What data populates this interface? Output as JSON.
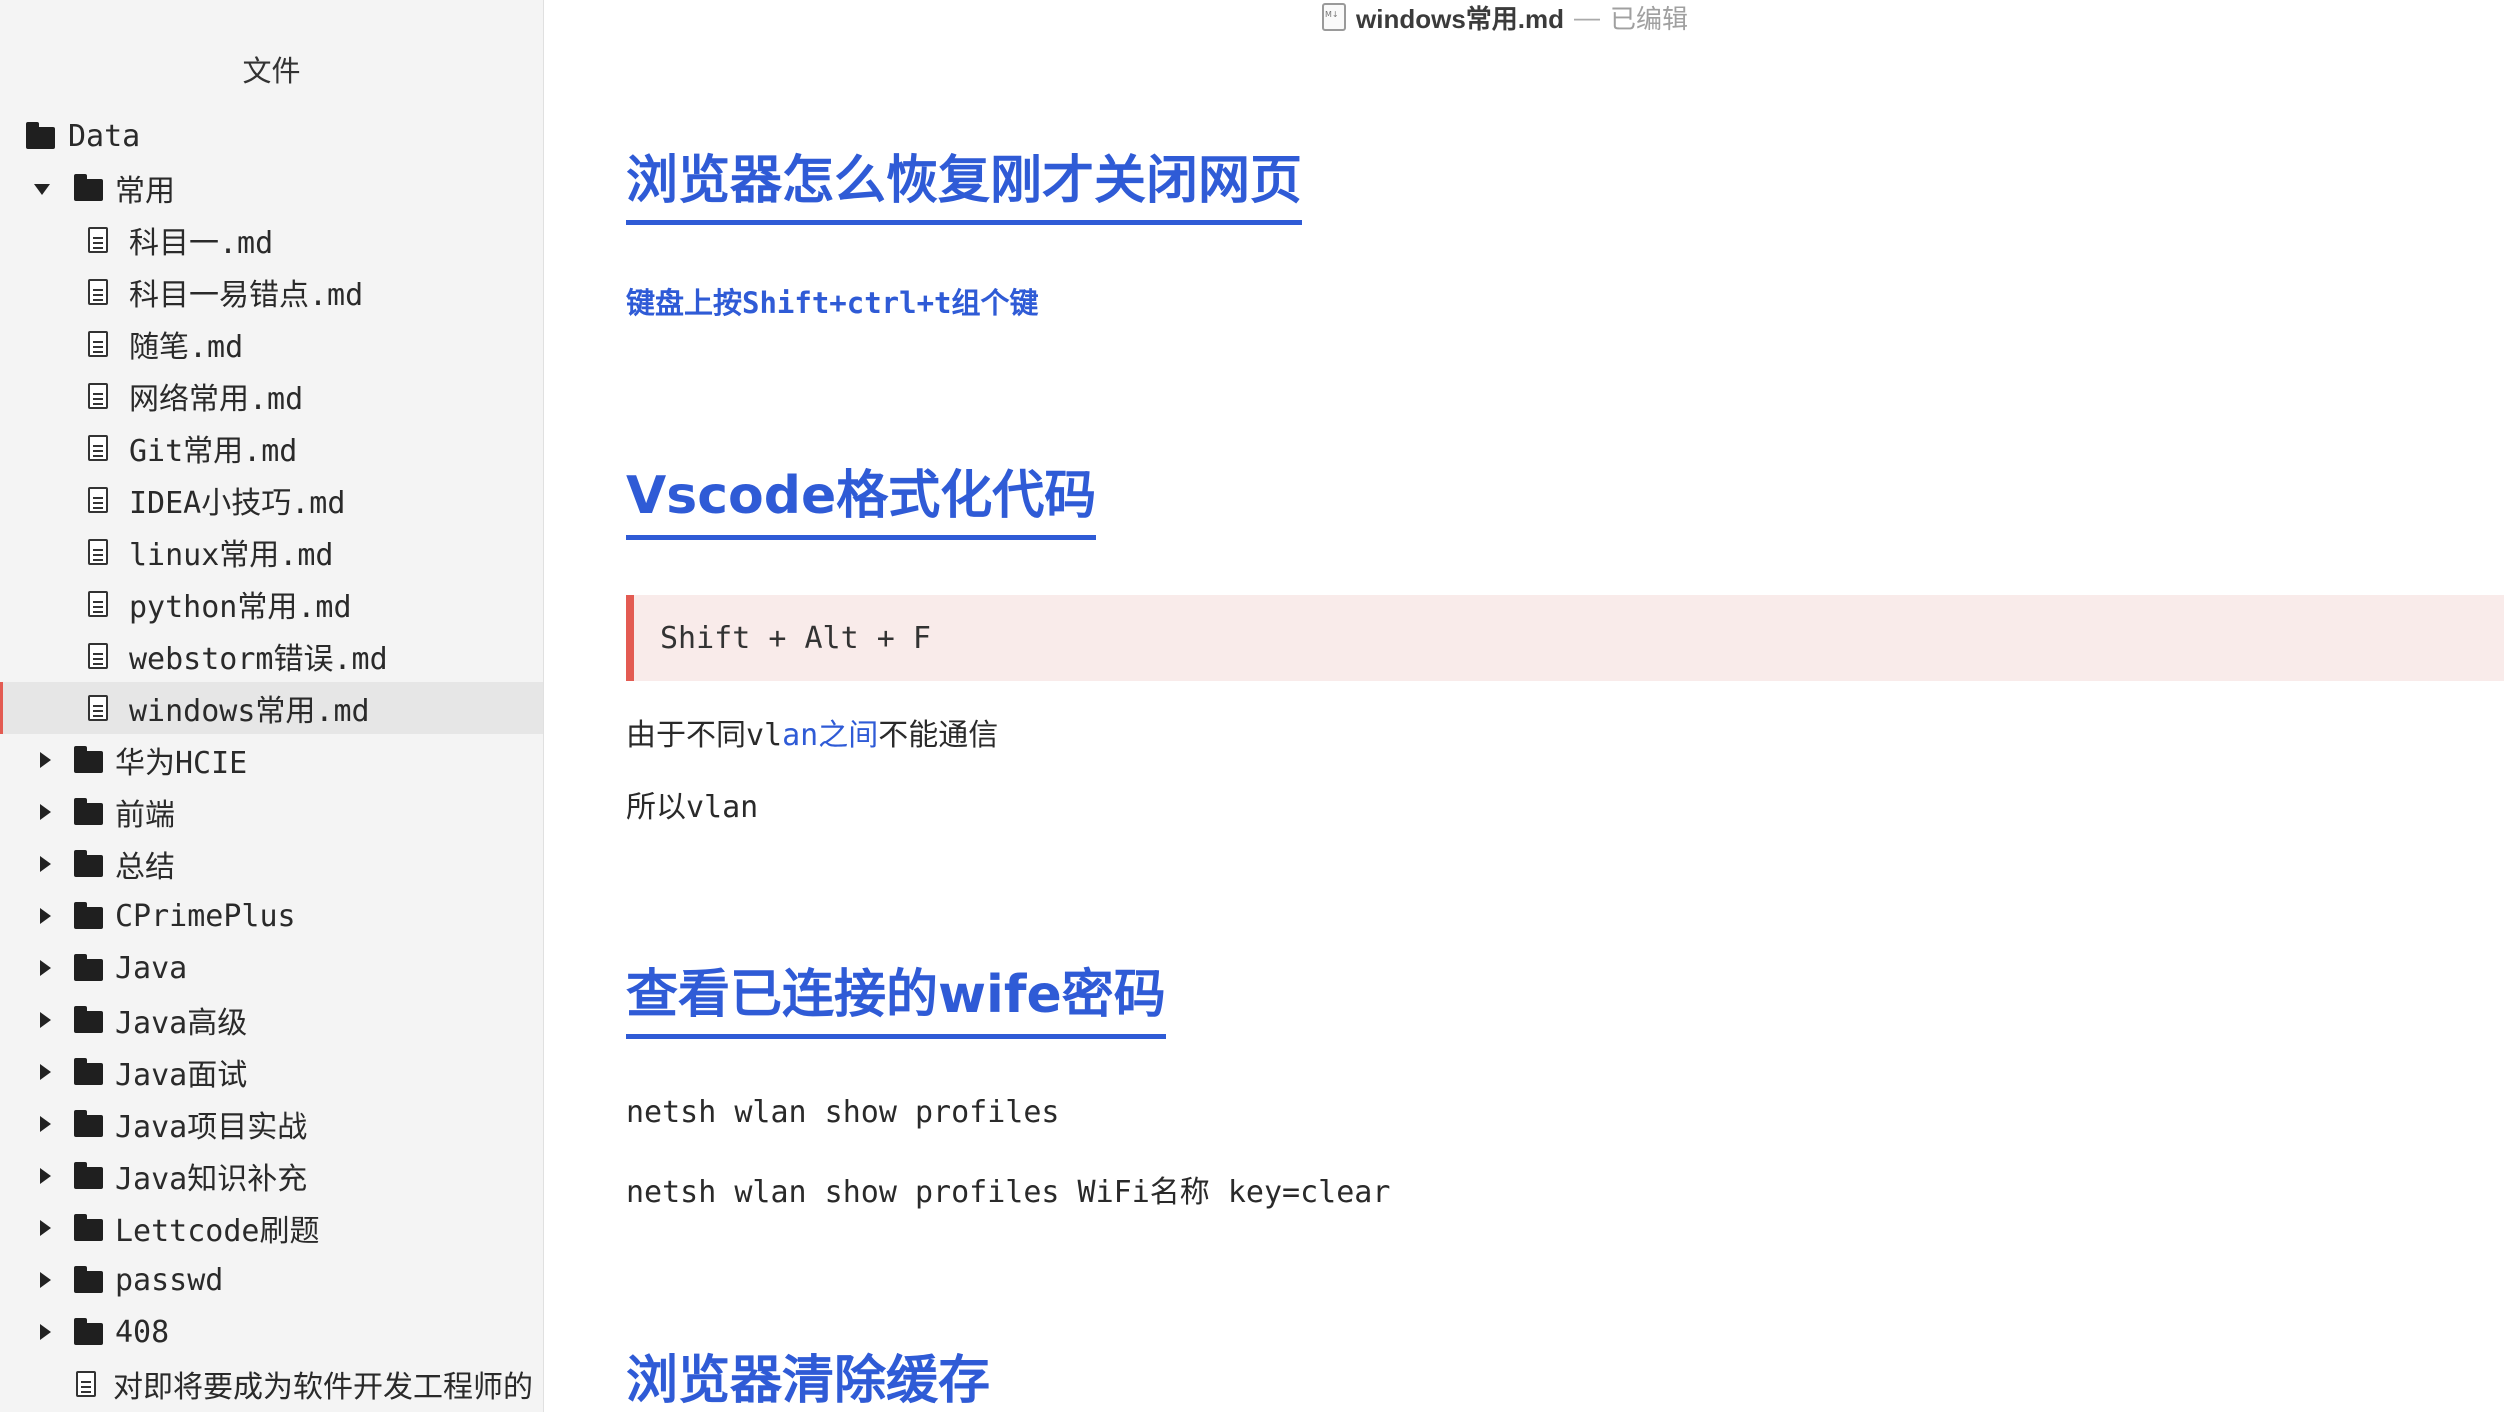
{
  "window": {
    "file_name": "windows常用.md",
    "separator": "—",
    "status": "已编辑"
  },
  "sidebar": {
    "title": "文件",
    "items": [
      {
        "type": "folder",
        "label": "Data",
        "depth": 0,
        "arrow": "none"
      },
      {
        "type": "folder",
        "label": "常用",
        "depth": 1,
        "arrow": "down"
      },
      {
        "type": "file",
        "label": "科目一.md",
        "depth": 2
      },
      {
        "type": "file",
        "label": "科目一易错点.md",
        "depth": 2
      },
      {
        "type": "file",
        "label": "随笔.md",
        "depth": 2
      },
      {
        "type": "file",
        "label": "网络常用.md",
        "depth": 2
      },
      {
        "type": "file",
        "label": "Git常用.md",
        "depth": 2
      },
      {
        "type": "file",
        "label": "IDEA小技巧.md",
        "depth": 2
      },
      {
        "type": "file",
        "label": "linux常用.md",
        "depth": 2
      },
      {
        "type": "file",
        "label": "python常用.md",
        "depth": 2
      },
      {
        "type": "file",
        "label": "webstorm错误.md",
        "depth": 2
      },
      {
        "type": "file",
        "label": "windows常用.md",
        "depth": 2,
        "active": true
      },
      {
        "type": "folder",
        "label": "华为HCIE",
        "depth": 1,
        "arrow": "right"
      },
      {
        "type": "folder",
        "label": "前端",
        "depth": 1,
        "arrow": "right"
      },
      {
        "type": "folder",
        "label": "总结",
        "depth": 1,
        "arrow": "right"
      },
      {
        "type": "folder",
        "label": "CPrimePlus",
        "depth": 1,
        "arrow": "right"
      },
      {
        "type": "folder",
        "label": "Java",
        "depth": 1,
        "arrow": "right"
      },
      {
        "type": "folder",
        "label": "Java高级",
        "depth": 1,
        "arrow": "right"
      },
      {
        "type": "folder",
        "label": "Java面试",
        "depth": 1,
        "arrow": "right"
      },
      {
        "type": "folder",
        "label": "Java项目实战",
        "depth": 1,
        "arrow": "right"
      },
      {
        "type": "folder",
        "label": "Java知识补充",
        "depth": 1,
        "arrow": "right"
      },
      {
        "type": "folder",
        "label": "Lettcode刷题",
        "depth": 1,
        "arrow": "right"
      },
      {
        "type": "folder",
        "label": "passwd",
        "depth": 1,
        "arrow": "right"
      },
      {
        "type": "folder",
        "label": "408",
        "depth": 1,
        "arrow": "right"
      },
      {
        "type": "file",
        "label": "对即将要成为软件开发工程师的",
        "depth": 1
      }
    ]
  },
  "content": {
    "h1_1": "浏览器怎么恢复刚才关闭网页",
    "bold_1": "键盘上按Shift+ctrl+t组个键",
    "h1_2": "Vscode格式化代码",
    "code_1": "Shift + Alt + F",
    "para_1_a": "由于不同vl",
    "para_1_b": "an之间",
    "para_1_c": "不能通信",
    "para_2": "所以vlan",
    "h1_3": "查看已连接的wife密码",
    "para_3": "netsh wlan show profiles",
    "para_4": "netsh wlan show profiles WiFi名称 key=clear",
    "h1_4": "浏览器清除缓存"
  },
  "colors": {
    "heading": "#2f5bd6",
    "accent_red": "#e35b52",
    "code_bg": "#f9ebea",
    "sidebar_bg": "#f4f4f4"
  }
}
